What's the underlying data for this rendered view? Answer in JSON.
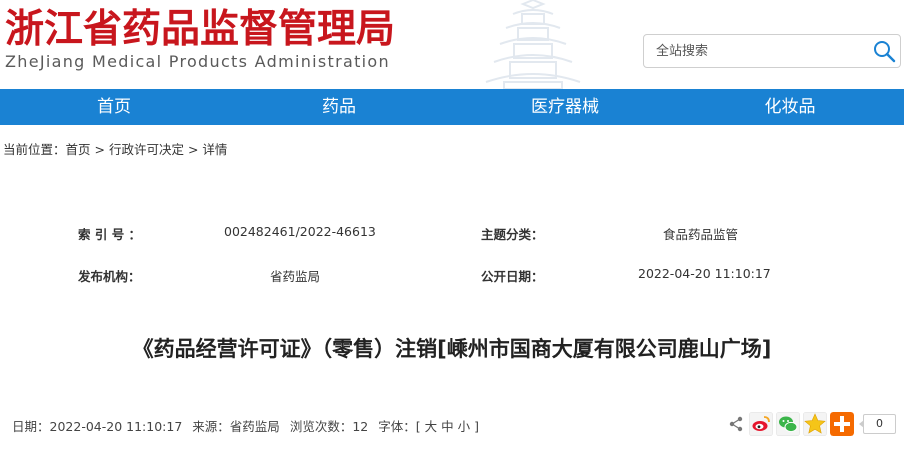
{
  "site": {
    "title_cn": "浙江省药品监督管理局",
    "title_en": "ZheJiang Medical Products Administration"
  },
  "search": {
    "placeholder": "全站搜索"
  },
  "nav": {
    "items": [
      {
        "label": "首页"
      },
      {
        "label": "药品"
      },
      {
        "label": "医疗器械"
      },
      {
        "label": "化妆品"
      }
    ]
  },
  "breadcrumb": {
    "prefix": "当前位置：",
    "home": "首页",
    "sep": " > ",
    "section": "行政许可决定",
    "current": "详情"
  },
  "meta": {
    "index_label": "索 引 号 ：",
    "index_value": "002482461/2022-46613",
    "topic_label": "主题分类：",
    "topic_value": "食品药品监管",
    "publisher_label": "发布机构：",
    "publisher_value": "省药监局",
    "date_label": "公开日期：",
    "date_value": "2022-04-20 11:10:17"
  },
  "article": {
    "title": "《药品经营许可证》（零售）注销[嵊州市国商大厦有限公司鹿山广场]"
  },
  "info": {
    "date_label": "日期：",
    "date_value": "2022-04-20 11:10:17",
    "source_label": "来源：",
    "source_value": "省药监局",
    "views_label": "浏览次数：",
    "views_value": "12",
    "font_label": "字体：[",
    "font_large": "大",
    "font_medium": "中",
    "font_small": "小",
    "font_end": "]"
  },
  "share": {
    "count": "0",
    "icons": [
      "share-icon",
      "weibo-icon",
      "wechat-icon",
      "qzone-icon",
      "more-share-icon"
    ]
  },
  "colors": {
    "brand_red": "#c8161d",
    "nav_blue": "#1a82d3"
  }
}
